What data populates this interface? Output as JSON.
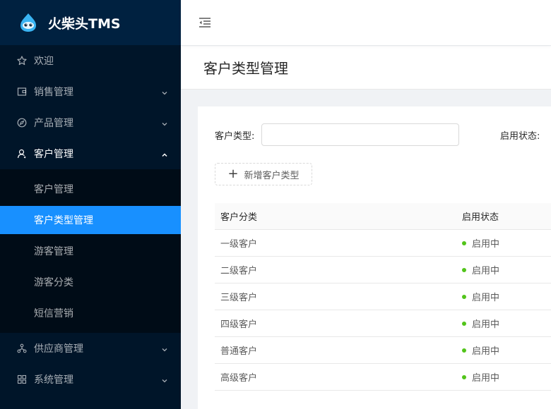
{
  "app": {
    "title": "火柴头TMS"
  },
  "sidebar": {
    "items": [
      {
        "label": "欢迎",
        "icon": "star-icon"
      },
      {
        "label": "销售管理",
        "icon": "wallet-icon"
      },
      {
        "label": "产品管理",
        "icon": "compass-icon"
      },
      {
        "label": "客户管理",
        "icon": "user-icon"
      },
      {
        "label": "供应商管理",
        "icon": "network-icon"
      },
      {
        "label": "系统管理",
        "icon": "appstore-icon"
      }
    ],
    "submenu": [
      {
        "label": "客户管理"
      },
      {
        "label": "客户类型管理"
      },
      {
        "label": "游客管理"
      },
      {
        "label": "游客分类"
      },
      {
        "label": "短信营销"
      }
    ]
  },
  "page": {
    "title": "客户类型管理"
  },
  "filters": {
    "type_label": "客户类型:",
    "type_value": "",
    "status_label": "启用状态:"
  },
  "add_button": {
    "label": "新增客户类型"
  },
  "table": {
    "columns": [
      "客户分类",
      "启用状态"
    ],
    "rows": [
      {
        "category": "一级客户",
        "status": "启用中"
      },
      {
        "category": "二级客户",
        "status": "启用中"
      },
      {
        "category": "三级客户",
        "status": "启用中"
      },
      {
        "category": "四级客户",
        "status": "启用中"
      },
      {
        "category": "普通客户",
        "status": "启用中"
      },
      {
        "category": "高级客户",
        "status": "启用中"
      }
    ]
  },
  "colors": {
    "sidebar_bg": "#001529",
    "logo_bg": "#002140",
    "submenu_bg": "#000c17",
    "primary": "#1890ff",
    "status_active": "#52c41a"
  }
}
